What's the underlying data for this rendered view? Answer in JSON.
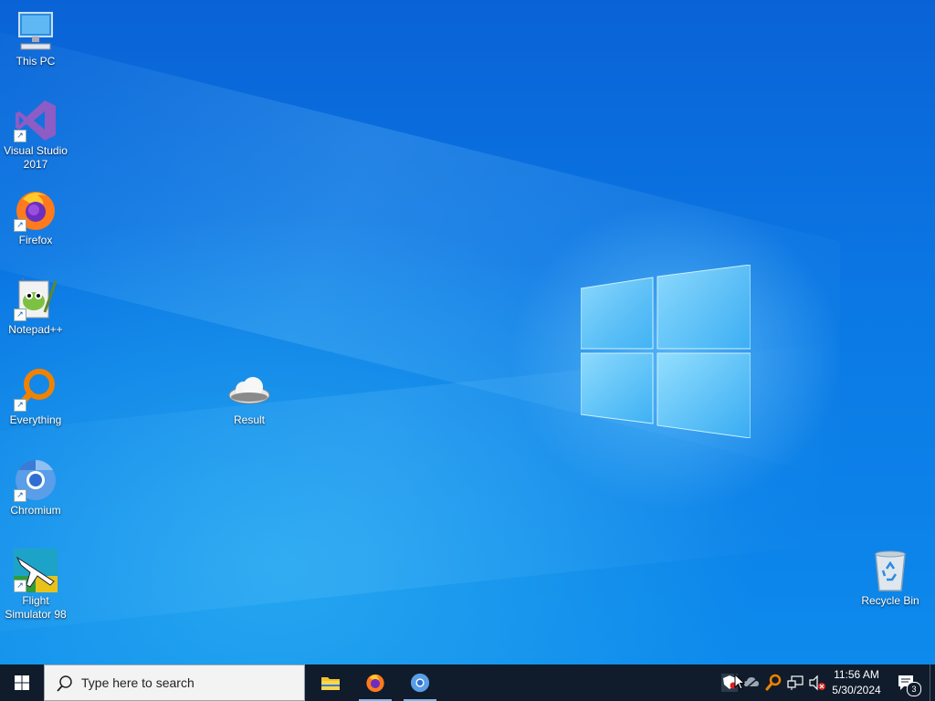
{
  "desktop": {
    "icons": [
      {
        "label": "This PC",
        "icon": "computer-icon"
      },
      {
        "label": "Visual Studio\n2017",
        "icon": "visual-studio-icon"
      },
      {
        "label": "Firefox",
        "icon": "firefox-icon"
      },
      {
        "label": "Notepad++",
        "icon": "notepad-plus-plus-icon"
      },
      {
        "label": "Everything",
        "icon": "everything-search-icon"
      },
      {
        "label": "Chromium",
        "icon": "chromium-icon"
      },
      {
        "label": "Flight\nSimulator 98",
        "icon": "flight-simulator-icon"
      },
      {
        "label": "Result",
        "icon": "cloud-icon"
      },
      {
        "label": "Recycle Bin",
        "icon": "recycle-bin-icon"
      }
    ]
  },
  "taskbar": {
    "search_placeholder": "Type here to search",
    "pinned": [
      {
        "name": "File Explorer",
        "icon": "folder-icon"
      },
      {
        "name": "Firefox",
        "icon": "firefox-icon"
      },
      {
        "name": "Chromium",
        "icon": "chromium-icon"
      }
    ],
    "tray": {
      "time": "11:56 AM",
      "date": "5/30/2024",
      "notification_count": "3"
    }
  },
  "colors": {
    "taskbar": "#101c2b",
    "desktop_blue": "#0b78e4",
    "accent": "#7fb7ea"
  }
}
